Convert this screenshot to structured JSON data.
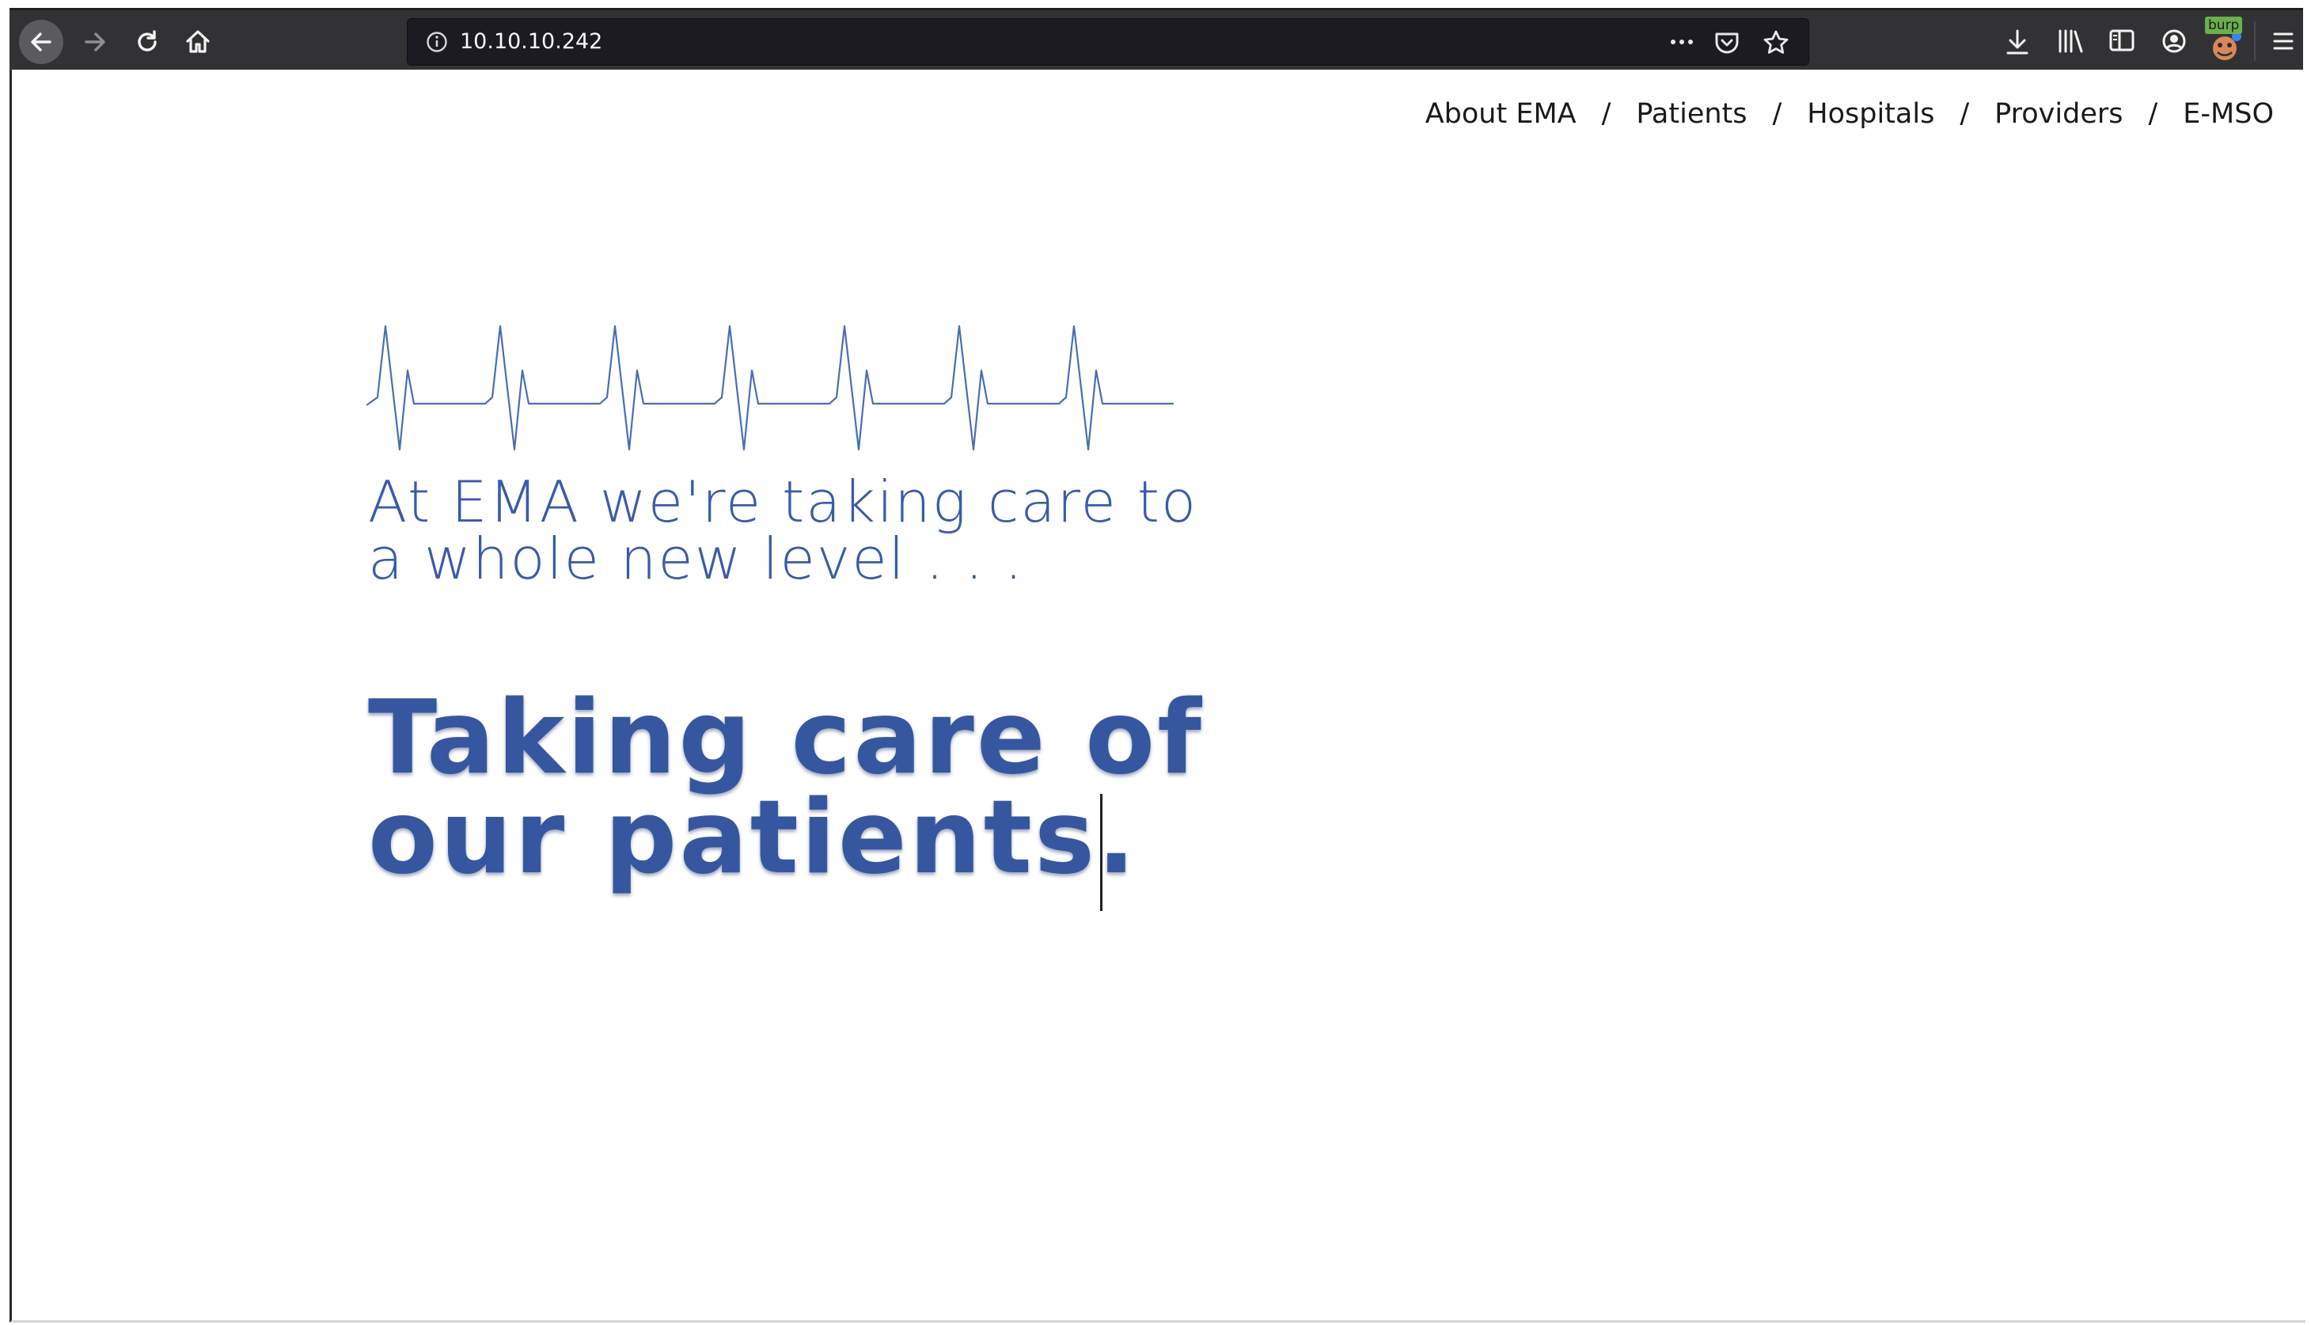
{
  "browser": {
    "url": "10.10.10.242",
    "burp_badge": "burp"
  },
  "nav": {
    "items": [
      "About EMA",
      "Patients",
      "Hospitals",
      "Providers",
      "E-MSO"
    ],
    "separator": "/"
  },
  "hero": {
    "tagline_line1": "At EMA we're taking care to",
    "tagline_line2": "a whole new level . . .",
    "headline_line1": "Taking care of",
    "headline_line2": "our patients."
  },
  "colors": {
    "brand_blue": "#36579f",
    "tagline_blue": "#3a5ba8",
    "toolbar": "#323234"
  }
}
